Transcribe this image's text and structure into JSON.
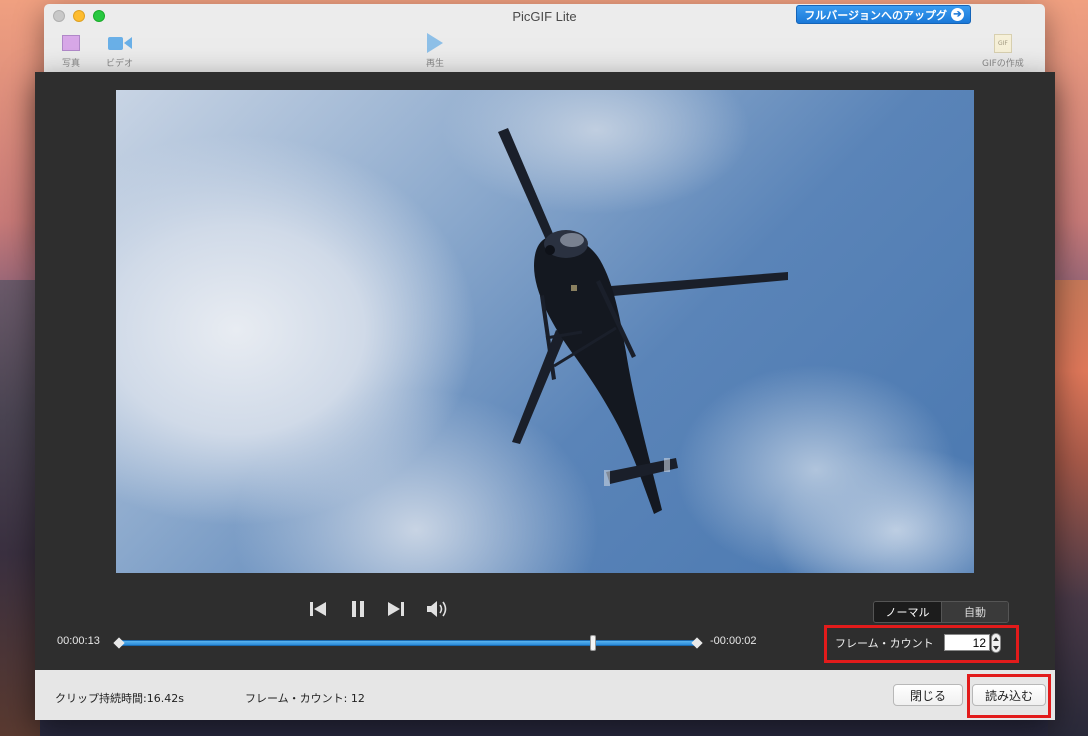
{
  "window": {
    "title": "PicGIF Lite",
    "upgrade_label": "フルバージョンへのアップグ"
  },
  "toolbar": {
    "photo_label": "写真",
    "video_label": "ビデオ",
    "play_label": "再生",
    "create_gif_label": "GIFの作成",
    "gif_icon_text": "GIF"
  },
  "player": {
    "time_elapsed": "00:00:13",
    "time_remaining": "-00:00:02",
    "playhead_fraction": 0.82,
    "mode_normal": "ノーマル",
    "mode_auto": "自動",
    "frame_count_label": "フレーム・カウント",
    "frame_count_value": "12"
  },
  "footer": {
    "clip_duration": "クリップ持続時間:16.42s",
    "frame_count": "フレーム・カウント: 12",
    "close_label": "閉じる",
    "load_label": "読み込む"
  },
  "colors": {
    "highlight": "#e21b1b",
    "accent": "#2a8ad8"
  }
}
